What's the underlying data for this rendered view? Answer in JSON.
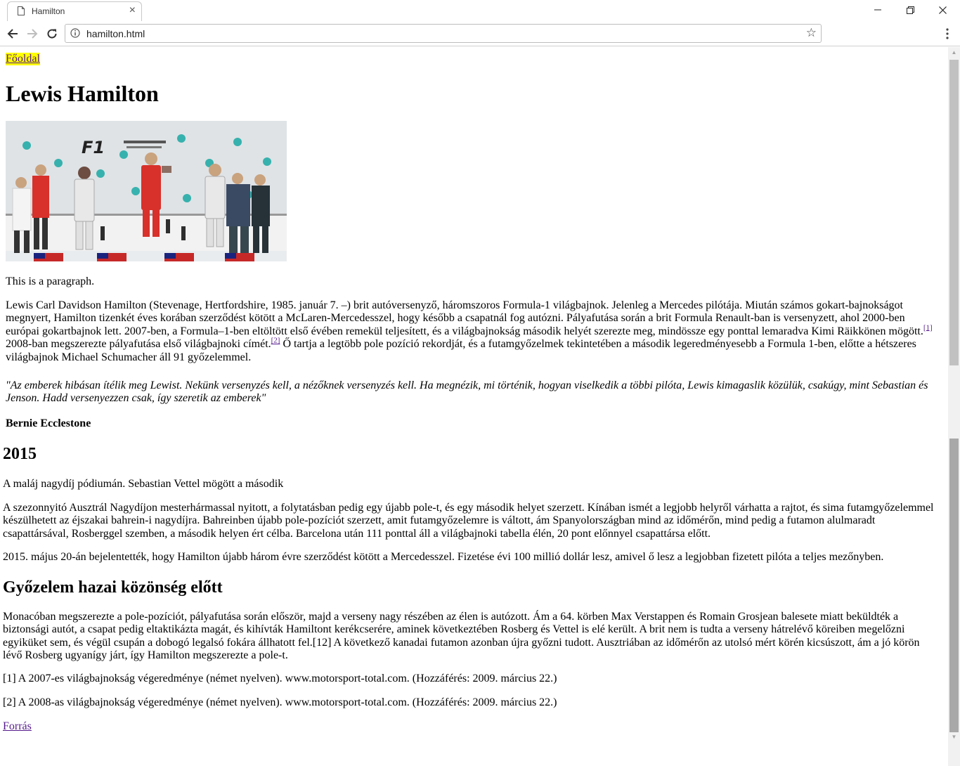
{
  "browser": {
    "tab_title": "Hamilton",
    "url": "hamilton.html"
  },
  "page": {
    "home_link": "Főoldal",
    "title": "Lewis Hamilton",
    "image_alt": "Formula-1 Malajziai Nagydíj dobogó",
    "intro_para": "This is a paragraph.",
    "bio": {
      "part1": "Lewis Carl Davidson Hamilton (Stevenage, Hertfordshire, 1985. január 7. –) brit autóversenyző, háromszoros Formula-1 világbajnok. Jelenleg a Mercedes pilótája. Miután számos gokart-bajnokságot megnyert, Hamilton tizenkét éves korában szerződést kötött a McLaren-Mercedesszel, hogy később a csapatnál fog autózni. Pályafutása során a brit Formula Renault-ban is versenyzett, ahol 2000-ben európai gokartbajnok lett. 2007-ben, a Formula–1-ben eltöltött első évében remekül teljesített, és a világbajnokság második helyét szerezte meg, mindössze egy ponttal lemaradva Kimi Räikkönen mögött.",
      "ref1": "[1]",
      "part2": " 2008-ban megszerezte pályafutása első világbajnoki címét.",
      "ref2": "[2]",
      "part3": " Ő tartja a legtöbb pole pozíció rekordját, és a futamgyőzelmek tekintetében a második legeredményesebb a Formula 1-ben, előtte a hétszeres világbajnok Michael Schumacher áll 91 győzelemmel."
    },
    "quote": "\"Az emberek hibásan ítélik meg Lewist. Nekünk versenyzés kell, a nézőknek versenyzés kell. Ha megnézik, mi történik, hogyan viselkedik a többi pilóta, Lewis kimagaslik közülük, csakúgy, mint Sebastian és Jenson. Hadd versenyezzen csak, így szeretik az emberek\"",
    "quote_author": "Bernie Ecclestone",
    "section_2015": {
      "heading": "2015",
      "caption": "A maláj nagydíj pódiumán. Sebastian Vettel mögött a második",
      "para1": "A szezonnyitó Ausztrál Nagydíjon mesterhármassal nyitott, a folytatásban pedig egy újabb pole-t, és egy második helyet szerzett. Kínában ismét a legjobb helyről várhatta a rajtot, és sima futamgyőzelemmel készülhetett az éjszakai bahrein-i nagydíjra. Bahreinben újabb pole-pozíciót szerzett, amit futamgyőzelemre is váltott, ám Spanyolországban mind az időmérőn, mind pedig a futamon alulmaradt csapattársával, Rosberggel szemben, a második helyen ért célba. Barcelona után 111 ponttal áll a világbajnoki tabella élén, 20 pont előnnyel csapattársa előtt.",
      "para2": "2015. május 20-án bejelentették, hogy Hamilton újabb három évre szerződést kötött a Mercedesszel. Fizetése évi 100 millió dollár lesz, amivel ő lesz a legjobban fizetett pilóta a teljes mezőnyben."
    },
    "section_home": {
      "heading": "Győzelem hazai közönség előtt",
      "para": "Monacóban megszerezte a pole-pozíciót, pályafutása során először, majd a verseny nagy részében az élen is autózott. Ám a 64. körben Max Verstappen és Romain Grosjean balesete miatt beküldték a biztonsági autót, a csapat pedig eltaktikázta magát, és kihívták Hamiltont kerékcserére, aminek következtében Rosberg és Vettel is elé került. A brit nem is tudta a verseny hátrelévő köreiben megelőzni egyiküket sem, és végül csupán a dobogó legalsó fokára állhatott fel.[12] A következő kanadai futamon azonban újra győzni tudott. Ausztriában az időmérőn az utolsó mért körén kicsúszott, ám a jó körön lévő Rosberg ugyanígy járt, így Hamilton megszerezte a pole-t."
    },
    "references": [
      "[1] A 2007-es világbajnokság végeredménye (német nyelven). www.motorsport-total.com. (Hozzáférés: 2009. március 22.)",
      "[2] A 2008-as világbajnokság végeredménye (német nyelven). www.motorsport-total.com. (Hozzáférés: 2009. március 22.)"
    ],
    "source_link": "Forrás"
  },
  "colors": {
    "highlight": "#ffff00",
    "visited_link": "#551a8b",
    "ferrari_red": "#d8302a",
    "petronas_teal": "#00a19b"
  },
  "icons": [
    "document-icon",
    "close-icon",
    "minimize-icon",
    "restore-icon",
    "window-close-icon",
    "back-icon",
    "forward-icon",
    "reload-icon",
    "info-icon",
    "star-icon",
    "menu-icon"
  ]
}
